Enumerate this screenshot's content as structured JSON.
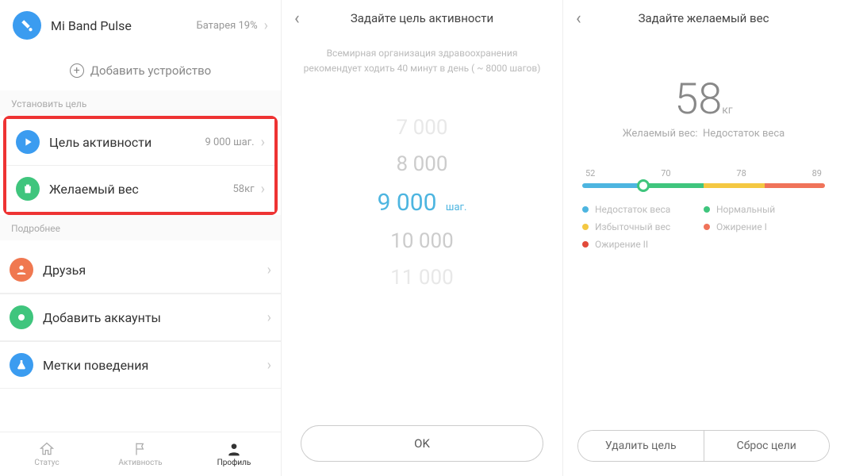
{
  "p1": {
    "device": {
      "name": "Mi Band Pulse",
      "battery": "Батарея 19%"
    },
    "add_device": "Добавить устройство",
    "section_goals": "Установить цель",
    "goal_activity": {
      "label": "Цель активности",
      "value": "9 000 шаг."
    },
    "goal_weight": {
      "label": "Желаемый вес",
      "value": "58кг"
    },
    "section_more": "Подробнее",
    "friends": "Друзья",
    "accounts": "Добавить аккаунты",
    "tags": "Метки поведения",
    "tabs": {
      "status": "Статус",
      "activity": "Активность",
      "profile": "Профиль"
    }
  },
  "p2": {
    "title": "Задайте цель активности",
    "who1": "Всемирная организация здравоохранения",
    "who2": "рекомендует ходить 40 минут в день ( ~ 8000 шагов)",
    "wheel": [
      "7 000",
      "8 000",
      "9 000",
      "10 000",
      "11 000"
    ],
    "unit": "шаг.",
    "ok": "OK"
  },
  "p3": {
    "title": "Задайте желаемый вес",
    "value": "58",
    "unit": "кг",
    "target_label": "Желаемый вес:",
    "target_status": "Недостаток веса",
    "ticks": [
      "52",
      "70",
      "78",
      "89"
    ],
    "legend": [
      {
        "color": "#4db5e0",
        "label": "Недостаток веса"
      },
      {
        "color": "#3fc57d",
        "label": "Нормальный"
      },
      {
        "color": "#f4c842",
        "label": "Избыточный вес"
      },
      {
        "color": "#f0735a",
        "label": "Ожирение I"
      },
      {
        "color": "#e24a3a",
        "label": "Ожирение II"
      }
    ],
    "btn_delete": "Удалить цель",
    "btn_reset": "Сброс цели"
  }
}
